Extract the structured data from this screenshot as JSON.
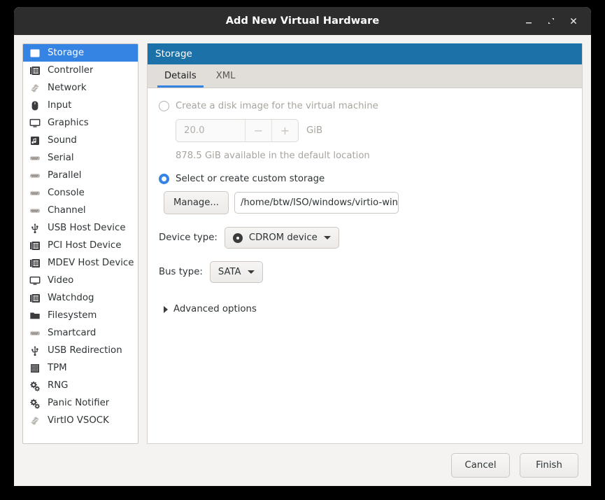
{
  "window": {
    "title": "Add New Virtual Hardware",
    "controls": [
      {
        "name": "minimize-button",
        "icon": "minimize-icon"
      },
      {
        "name": "maximize-button",
        "icon": "maximize-icon"
      },
      {
        "name": "close-button",
        "icon": "close-icon"
      }
    ]
  },
  "sidebar": {
    "items": [
      {
        "label": "Storage",
        "icon": "storage-icon",
        "selected": true
      },
      {
        "label": "Controller",
        "icon": "controller-card-icon",
        "selected": false
      },
      {
        "label": "Network",
        "icon": "network-icon",
        "selected": false
      },
      {
        "label": "Input",
        "icon": "mouse-icon",
        "selected": false
      },
      {
        "label": "Graphics",
        "icon": "display-icon",
        "selected": false
      },
      {
        "label": "Sound",
        "icon": "sound-icon",
        "selected": false
      },
      {
        "label": "Serial",
        "icon": "serial-port-icon",
        "selected": false
      },
      {
        "label": "Parallel",
        "icon": "serial-port-icon",
        "selected": false
      },
      {
        "label": "Console",
        "icon": "serial-port-icon",
        "selected": false
      },
      {
        "label": "Channel",
        "icon": "serial-port-icon",
        "selected": false
      },
      {
        "label": "USB Host Device",
        "icon": "usb-icon",
        "selected": false
      },
      {
        "label": "PCI Host Device",
        "icon": "controller-card-icon",
        "selected": false
      },
      {
        "label": "MDEV Host Device",
        "icon": "controller-card-icon",
        "selected": false
      },
      {
        "label": "Video",
        "icon": "display-icon",
        "selected": false
      },
      {
        "label": "Watchdog",
        "icon": "controller-card-icon",
        "selected": false
      },
      {
        "label": "Filesystem",
        "icon": "folder-icon",
        "selected": false
      },
      {
        "label": "Smartcard",
        "icon": "serial-port-icon",
        "selected": false
      },
      {
        "label": "USB Redirection",
        "icon": "usb-icon",
        "selected": false
      },
      {
        "label": "TPM",
        "icon": "chip-icon",
        "selected": false
      },
      {
        "label": "RNG",
        "icon": "gears-icon",
        "selected": false
      },
      {
        "label": "Panic Notifier",
        "icon": "gears-icon",
        "selected": false
      },
      {
        "label": "VirtIO VSOCK",
        "icon": "network-icon",
        "selected": false
      }
    ]
  },
  "main": {
    "header_title": "Storage",
    "tabs": [
      {
        "label": "Details",
        "active": true
      },
      {
        "label": "XML",
        "active": false
      }
    ],
    "create_disk": {
      "radio_label": "Create a disk image for the virtual machine",
      "checked": false,
      "enabled": false,
      "size_value": "20.0",
      "minus_label": "−",
      "plus_label": "+",
      "unit": "GiB",
      "available_text": "878.5 GiB available in the default location"
    },
    "custom_storage": {
      "radio_label": "Select or create custom storage",
      "checked": true,
      "manage_label": "Manage...",
      "path_value": "/home/btw/ISO/windows/virtio-win.iso"
    },
    "device_type": {
      "label": "Device type:",
      "value": "CDROM device",
      "icon": "cdrom-icon"
    },
    "bus_type": {
      "label": "Bus type:",
      "value": "SATA"
    },
    "advanced": {
      "label": "Advanced options",
      "expanded": false
    }
  },
  "footer": {
    "cancel_label": "Cancel",
    "finish_label": "Finish"
  },
  "colors": {
    "titlebar_bg": "#2d2d2d",
    "panel_header_bg": "#1c71a8",
    "selection_blue": "#3584e4",
    "dialog_bg": "#f4f3f2"
  }
}
